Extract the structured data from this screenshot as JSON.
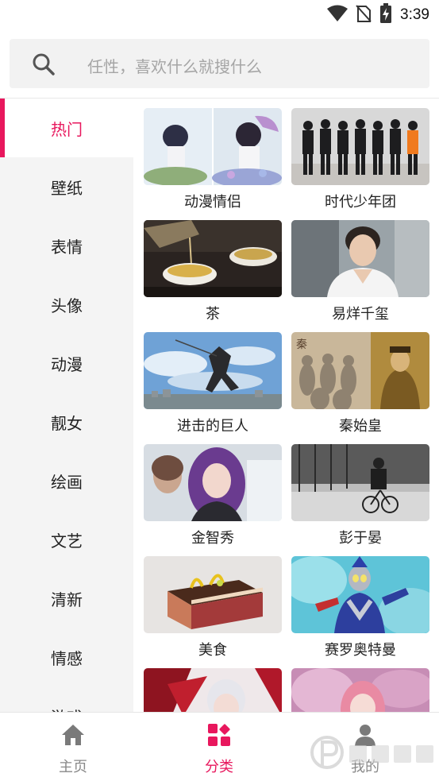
{
  "status_bar": {
    "time": "3:39",
    "icons": [
      "wifi-icon",
      "no-sim-icon",
      "battery-charging-icon"
    ]
  },
  "search": {
    "placeholder": "任性，喜欢什么就搜什么",
    "icon": "search-icon"
  },
  "sidebar": {
    "items": [
      {
        "label": "热门",
        "active": true
      },
      {
        "label": "壁纸"
      },
      {
        "label": "表情"
      },
      {
        "label": "头像"
      },
      {
        "label": "动漫"
      },
      {
        "label": "靓女"
      },
      {
        "label": "绘画"
      },
      {
        "label": "文艺"
      },
      {
        "label": "清新"
      },
      {
        "label": "情感"
      },
      {
        "label": "游戏"
      }
    ]
  },
  "grid": {
    "cards": [
      {
        "label": "动漫情侣",
        "image": "anime-couple-thumbnail"
      },
      {
        "label": "时代少年团",
        "image": "boy-band-thumbnail"
      },
      {
        "label": "茶",
        "image": "tea-thumbnail"
      },
      {
        "label": "易烊千玺",
        "image": "portrait-thumbnail"
      },
      {
        "label": "进击的巨人",
        "image": "attack-on-titan-thumbnail"
      },
      {
        "label": "秦始皇",
        "image": "terracotta-thumbnail"
      },
      {
        "label": "金智秀",
        "image": "portrait-purple-hair-thumbnail"
      },
      {
        "label": "彭于晏",
        "image": "cyclist-bw-thumbnail"
      },
      {
        "label": "美食",
        "image": "cake-thumbnail"
      },
      {
        "label": "赛罗奥特曼",
        "image": "ultraman-thumbnail"
      },
      {
        "label": "",
        "image": "anime-red-thumbnail"
      },
      {
        "label": "",
        "image": "anime-pink-thumbnail"
      }
    ]
  },
  "bottom_nav": {
    "items": [
      {
        "label": "主页",
        "icon": "home-icon"
      },
      {
        "label": "分类",
        "icon": "category-icon",
        "active": true
      },
      {
        "label": "我的",
        "icon": "profile-icon"
      }
    ]
  },
  "colors": {
    "accent": "#e8175d",
    "sidebar_bg": "#f4f4f4",
    "search_bg": "#f2f2f2"
  }
}
